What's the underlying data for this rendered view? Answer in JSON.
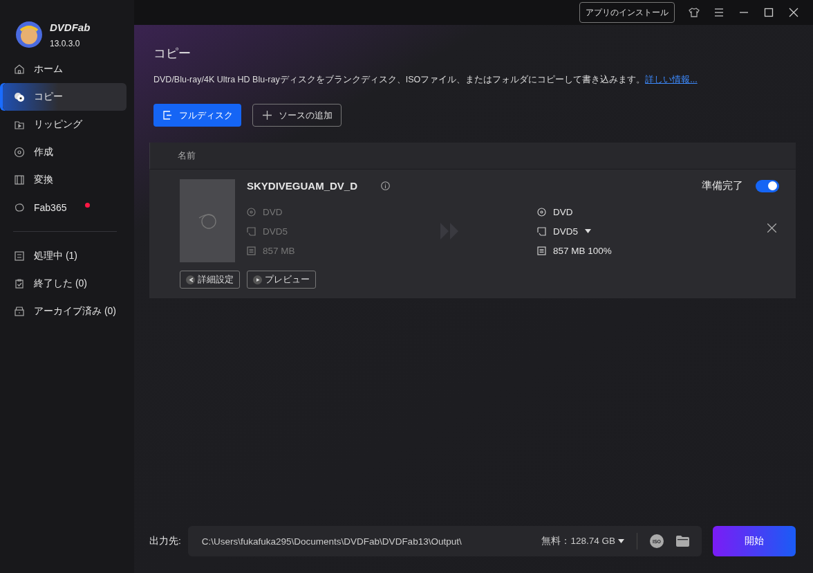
{
  "app": {
    "name": "DVDFab",
    "version": "13.0.3.0"
  },
  "sidebar": {
    "items": [
      {
        "label": "ホーム",
        "kind": "home",
        "selected": false,
        "notification": false
      },
      {
        "label": "コピー",
        "kind": "disc-pair",
        "selected": true,
        "notification": false
      },
      {
        "label": "リッピング",
        "kind": "rip",
        "selected": false,
        "notification": false
      },
      {
        "label": "作成",
        "kind": "disc",
        "selected": false,
        "notification": false
      },
      {
        "label": "変換",
        "kind": "film",
        "selected": false,
        "notification": false
      },
      {
        "label": "Fab365",
        "kind": "fab",
        "selected": false,
        "notification": true
      }
    ],
    "queue": [
      {
        "label": "処理中 (1)",
        "kind": "list",
        "selected": false
      },
      {
        "label": "終了した (0)",
        "kind": "clipboard",
        "selected": false
      },
      {
        "label": "アーカイブ済み (0)",
        "kind": "archive",
        "selected": false
      }
    ]
  },
  "titlebar": {
    "install_button": "アプリのインストール"
  },
  "page": {
    "title": "コピー",
    "description": "DVD/Blu-ray/4K Ultra HD Blu-rayディスクをブランクディスク、ISOファイル、またはフォルダにコピーして書き込みます。",
    "link": "詳しい情報..."
  },
  "buttons": [
    {
      "label": "フルディスク",
      "kind": "primary"
    },
    {
      "label": "ソースの追加",
      "kind": "add"
    }
  ],
  "table": {
    "columns": [
      "名前"
    ],
    "rows": [
      {
        "title": "SKYDIVEGUAM_DV_D",
        "source": {
          "disc": "DVD",
          "type": "DVD5",
          "size": "857 MB"
        },
        "target": {
          "disc": "DVD",
          "type": "DVD5",
          "size": "857 MB 100%"
        },
        "status": "準備完了",
        "enabled": true,
        "actions": [
          {
            "label": "詳細設定",
            "kind": "settings"
          },
          {
            "label": "プレビュー",
            "kind": "play"
          }
        ]
      }
    ]
  },
  "output": {
    "label": "出力先:",
    "path": "C:\\Users\\fukafuka295\\Documents\\DVDFab\\DVDFab13\\Output\\",
    "free": "無料：128.74 GB",
    "iso": "ISO"
  },
  "start_button": "開始"
}
